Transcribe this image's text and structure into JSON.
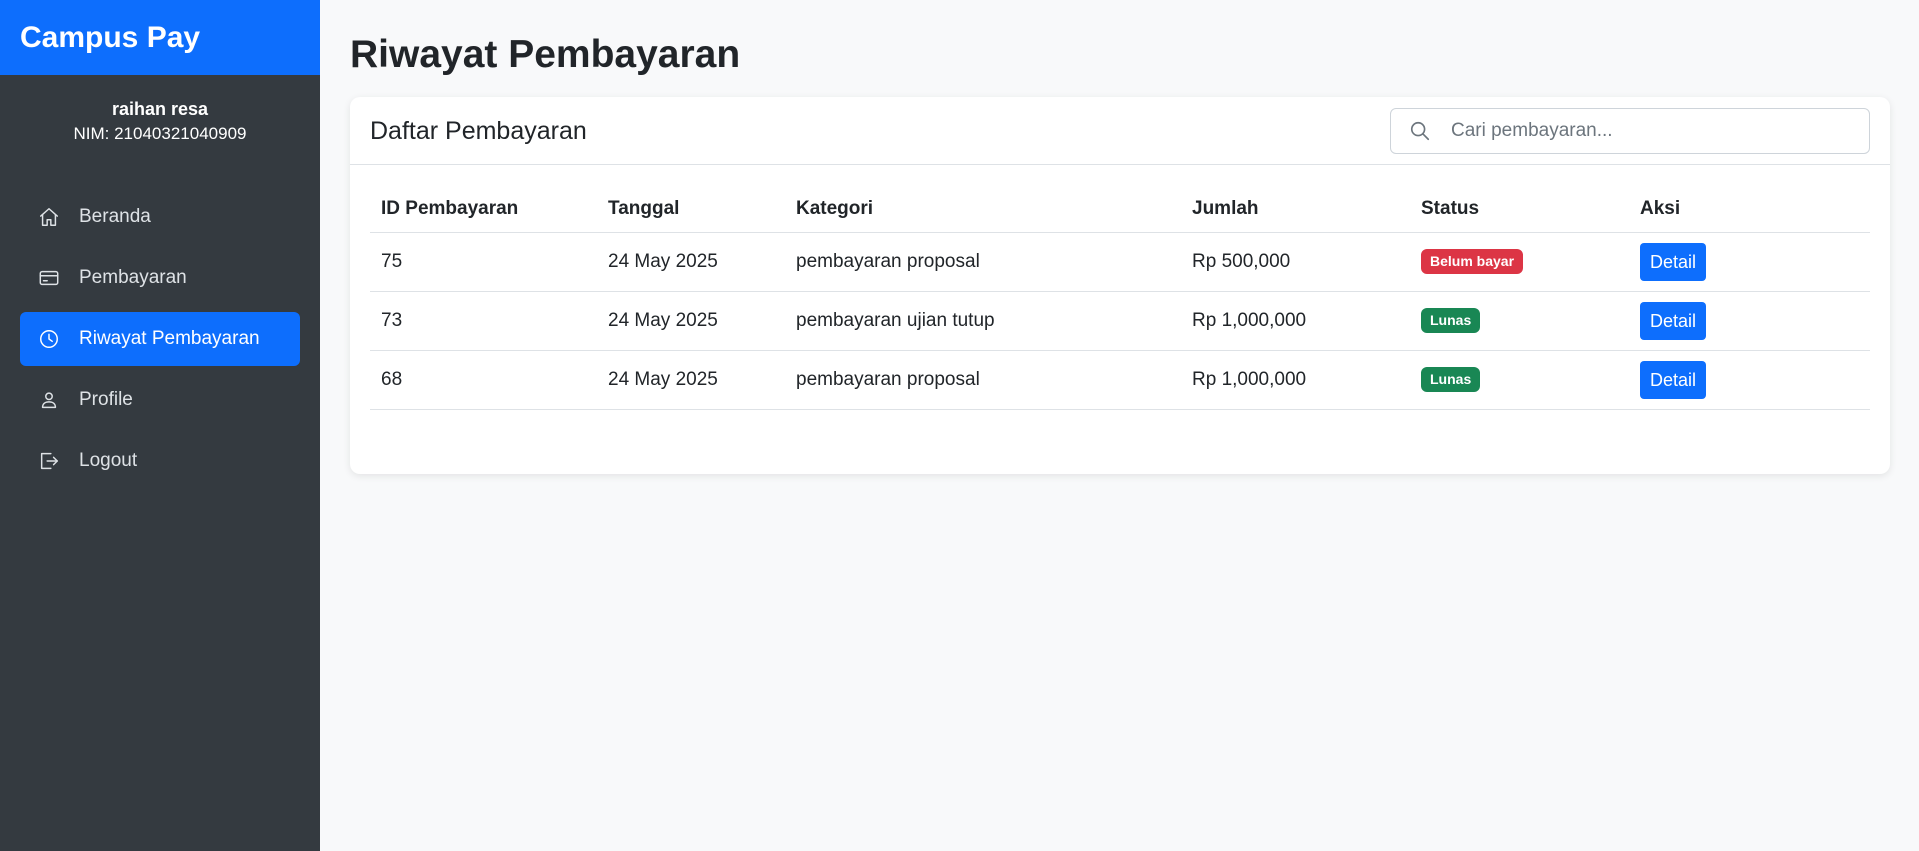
{
  "app": {
    "brand": "Campus Pay"
  },
  "user": {
    "name": "raihan resa",
    "nim": "NIM: 21040321040909"
  },
  "nav": {
    "items": [
      {
        "label": "Beranda",
        "icon": "home-icon"
      },
      {
        "label": "Pembayaran",
        "icon": "credit-card-icon"
      },
      {
        "label": "Riwayat Pembayaran",
        "icon": "clock-icon",
        "active": true
      },
      {
        "label": "Profile",
        "icon": "person-icon"
      },
      {
        "label": "Logout",
        "icon": "logout-icon"
      }
    ]
  },
  "page": {
    "title": "Riwayat Pembayaran"
  },
  "card": {
    "title": "Daftar Pembayaran",
    "search_placeholder": "Cari pembayaran..."
  },
  "table": {
    "headers": [
      "ID Pembayaran",
      "Tanggal",
      "Kategori",
      "Jumlah",
      "Status",
      "Aksi"
    ],
    "rows": [
      {
        "id": "75",
        "date": "24 May 2025",
        "category": "pembayaran proposal",
        "amount": "Rp 500,000",
        "status": "Belum bayar",
        "action": "Detail"
      },
      {
        "id": "73",
        "date": "24 May 2025",
        "category": "pembayaran ujian tutup",
        "amount": "Rp 1,000,000",
        "status": "Lunas",
        "action": "Detail"
      },
      {
        "id": "68",
        "date": "24 May 2025",
        "category": "pembayaran proposal",
        "amount": "Rp 1,000,000",
        "status": "Lunas",
        "action": "Detail"
      }
    ]
  },
  "colors": {
    "primary": "#0d6efd",
    "sidebar": "#343a40",
    "danger": "#dc3545",
    "success": "#198754"
  }
}
